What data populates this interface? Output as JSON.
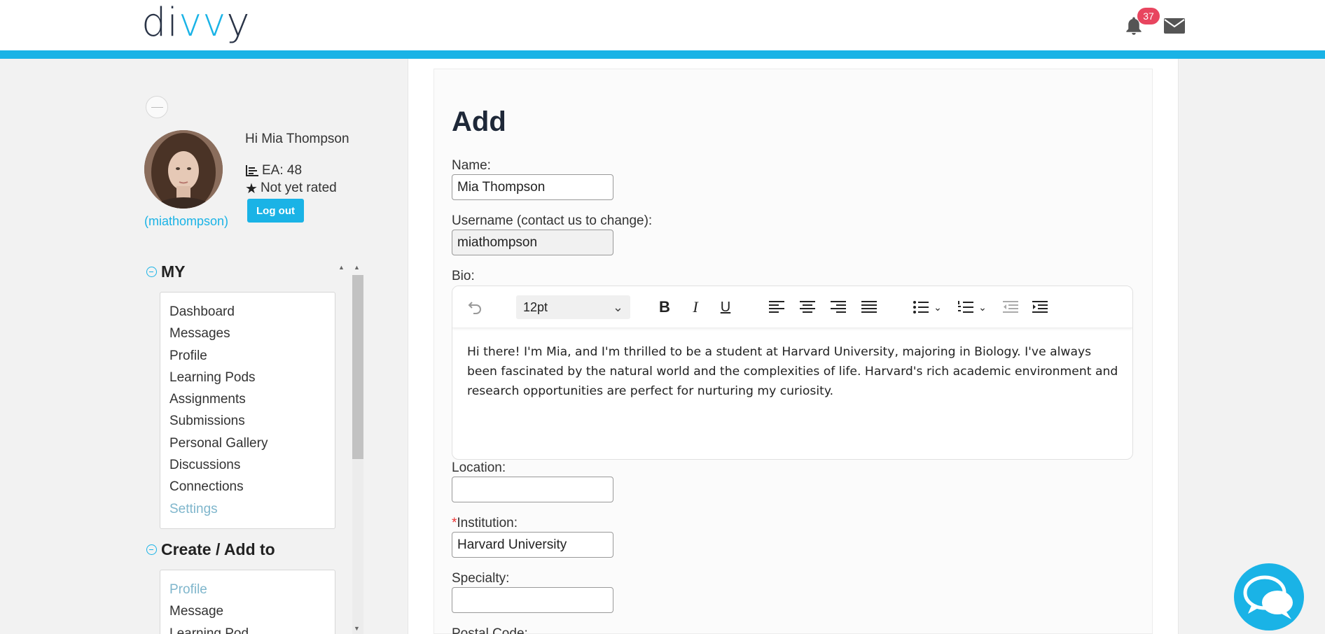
{
  "header": {
    "logo": {
      "pre": "di",
      "v1": "v",
      "v2": "v",
      "post": "y"
    },
    "notification_count": "37",
    "brand_color": "#1ab3e6",
    "badge_color": "#e8455f",
    "icons": [
      "bell-icon",
      "mail-icon"
    ]
  },
  "profile": {
    "greeting": "Hi Mia Thompson",
    "ea": "EA: 48",
    "rating": "Not yet rated",
    "logout_label": "Log out",
    "handle": "(miathompson)"
  },
  "sidebar": {
    "my_title": "MY",
    "my_items": [
      {
        "label": "Dashboard"
      },
      {
        "label": "Messages"
      },
      {
        "label": "Profile"
      },
      {
        "label": "Learning Pods"
      },
      {
        "label": "Assignments"
      },
      {
        "label": "Submissions"
      },
      {
        "label": "Personal Gallery"
      },
      {
        "label": "Discussions"
      },
      {
        "label": "Connections"
      },
      {
        "label": "Settings"
      }
    ],
    "create_title": "Create / Add to",
    "create_items": [
      {
        "label": "Profile"
      },
      {
        "label": "Message"
      },
      {
        "label": "Learning Pod"
      }
    ]
  },
  "form": {
    "title": "Add",
    "name_label": "Name:",
    "name_value": "Mia Thompson",
    "username_label": "Username (contact us to change):",
    "username_value": "miathompson",
    "bio_label": "Bio:",
    "font_size": "12pt",
    "bio_text": "Hi there! I'm Mia, and I'm thrilled to be a student at Harvard University, majoring in Biology. I've always been fascinated by the natural world and the complexities of life. Harvard's rich academic environment and research opportunities are perfect for nurturing my curiosity.",
    "location_label": "Location:",
    "location_value": "",
    "institution_required": "*",
    "institution_label": "Institution:",
    "institution_value": "Harvard University",
    "specialty_label": "Specialty:",
    "specialty_value": "",
    "postal_label": "Postal Code:"
  }
}
